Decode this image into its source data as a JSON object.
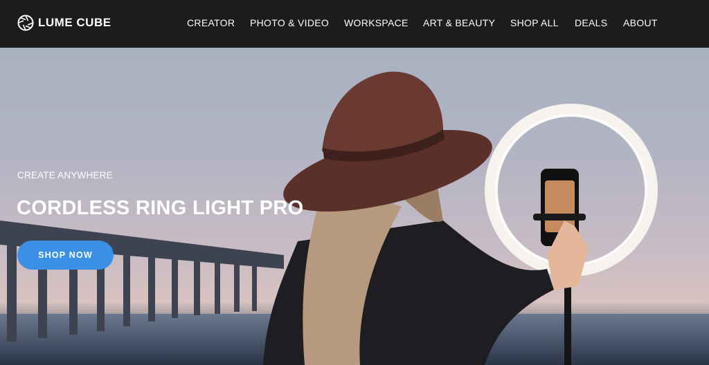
{
  "brand": {
    "name": "LUME CUBE",
    "logo_icon": "aperture-icon"
  },
  "nav": {
    "items": [
      {
        "label": "CREATOR"
      },
      {
        "label": "PHOTO & VIDEO"
      },
      {
        "label": "WORKSPACE"
      },
      {
        "label": "ART & BEAUTY"
      },
      {
        "label": "SHOP ALL"
      },
      {
        "label": "DEALS"
      },
      {
        "label": "ABOUT"
      }
    ]
  },
  "hero": {
    "eyebrow": "CREATE ANYWHERE",
    "headline": "CORDLESS RING LIGHT PRO",
    "cta_label": "SHOP NOW",
    "image": "woman-with-ring-light-photo"
  },
  "colors": {
    "navbar_bg": "#1c1c1c",
    "cta_bg": "#3b8fe4",
    "text": "#ffffff"
  }
}
